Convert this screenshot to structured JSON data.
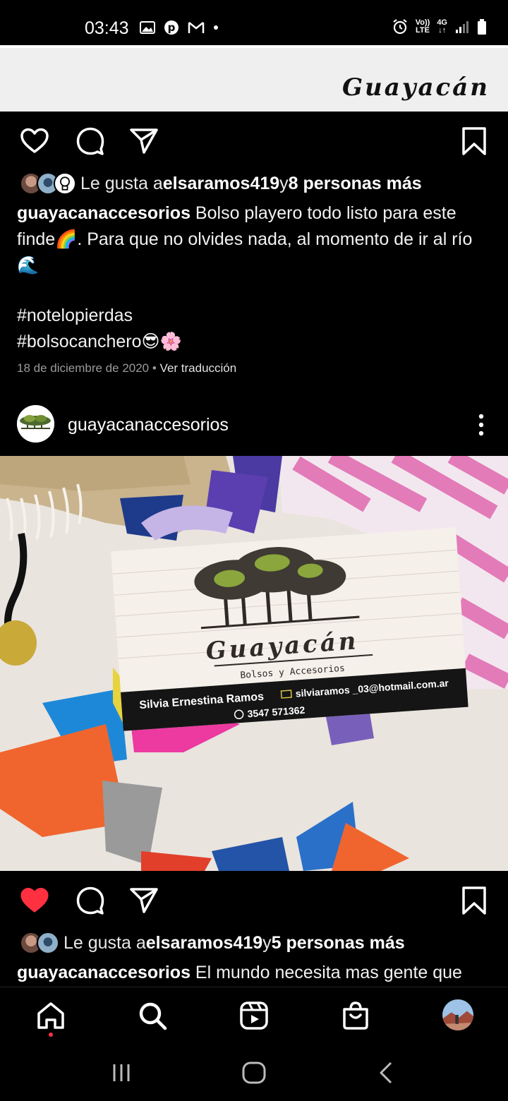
{
  "status_bar": {
    "time": "03:43",
    "network_top": "Vo))",
    "network_bottom": "LTE",
    "gen": "4G"
  },
  "banner": {
    "logo_text": "Guayacán"
  },
  "post1": {
    "likes": {
      "prefix": "Le gusta a ",
      "user": "elsaramos419",
      "middle": " y ",
      "others": "8 personas más"
    },
    "caption": {
      "user": "guayacanaccesorios",
      "text_line1": " Bolso playero todo listo para este",
      "text_line2": "finde🌈. Para que no olvides nada, al momento de ir al río",
      "text_line3": "🌊",
      "hashtag1": "#notelopierdas",
      "hashtag2": "#bolsocanchero😎🌸"
    },
    "date": "18 de diciembre de 2020",
    "separator": " • ",
    "translate": "Ver traducción"
  },
  "post2": {
    "username": "guayacanaccesorios",
    "card": {
      "brand": "Guayacán",
      "subtitle": "Bolsos y Accesorios",
      "owner": "Silvia Ernestina Ramos",
      "email": "silviaramos _03@hotmail.com.ar",
      "phone": "3547 571362"
    },
    "likes": {
      "prefix": "Le gusta a ",
      "user": "elsaramos419",
      "middle": " y ",
      "others": "5 personas más"
    },
    "caption": {
      "user": "guayacanaccesorios",
      "text": " El mundo necesita mas gente que"
    }
  },
  "colors": {
    "liked": "#ff3040",
    "background": "#000000",
    "muted_text": "#9a9a9a"
  },
  "icons": {
    "like": "heart-icon",
    "comment": "comment-icon",
    "share": "send-icon",
    "save": "bookmark-icon",
    "more": "more-vertical-icon",
    "home": "home-icon",
    "search": "search-icon",
    "reels": "reels-icon",
    "shop": "shop-icon"
  }
}
